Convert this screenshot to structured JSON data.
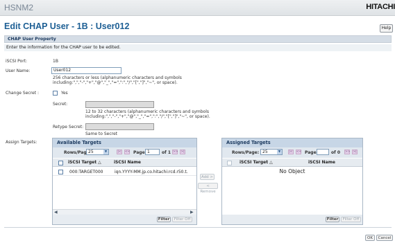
{
  "app": {
    "name": "HSNM2",
    "brand": "HITACHI"
  },
  "page": {
    "title": "Edit CHAP User - 1B : User012",
    "help_label": "Help"
  },
  "section": {
    "title": "CHAP User Property",
    "intro": "Enter the information for the CHAP user to be edited."
  },
  "form": {
    "iscsi_port_label": "iSCSI Port:",
    "iscsi_port_value": "1B",
    "user_name_label": "User Name:",
    "user_name_value": "User012",
    "user_name_hint1": "256 characters or less (alphanumeric characters and symbols",
    "user_name_hint2": "including:\",\",\"-\",\"+\",\"@\",\"_\",\"=\",\":\",\"/\",\"[\",\"]\",\"~\", or space).",
    "change_secret_label": "Change Secret :",
    "change_secret_option": "Yes",
    "secret_label": "Secret:",
    "secret_hint1": "12 to 32 characters (alphanumeric characters and symbols",
    "secret_hint2": "including:\",\",\"-\",\"+\",\"@\",\"_\",\"=\",\":\",\"/\",\"[\",\"]\",\"~\", or space).",
    "retype_label": "Retype Secret:",
    "same_as_secret": "Same to Secret",
    "assign_targets_label": "Assign Targets:"
  },
  "available": {
    "title": "Available Targets",
    "rows_label": "Rows/Page:",
    "rows_value": "25",
    "page_label": "Page",
    "page_value": "1",
    "of_label": "of 1",
    "col1": "iSCSI Target △",
    "col2": "iSCSI Name",
    "rows": [
      {
        "target": "000:TARGET000",
        "name": "iqn.YYYY-MM.jp.co.hitachi:rcd.r50.t."
      }
    ],
    "filter": "Filter",
    "filter_off": "Filter Off"
  },
  "assigned": {
    "title": "Assigned Targets",
    "rows_label": "Rows/Page:",
    "rows_value": "25",
    "page_label": "Page",
    "page_value": "",
    "of_label": "of 0",
    "col1": "iSCSI Target △",
    "col2": "iSCSI Name",
    "empty": "No Object",
    "filter": "Filter",
    "filter_off": "Filter Off"
  },
  "actions": {
    "add": "Add >",
    "remove": "< Remove"
  },
  "footer": {
    "ok": "OK",
    "cancel": "Cancel"
  }
}
